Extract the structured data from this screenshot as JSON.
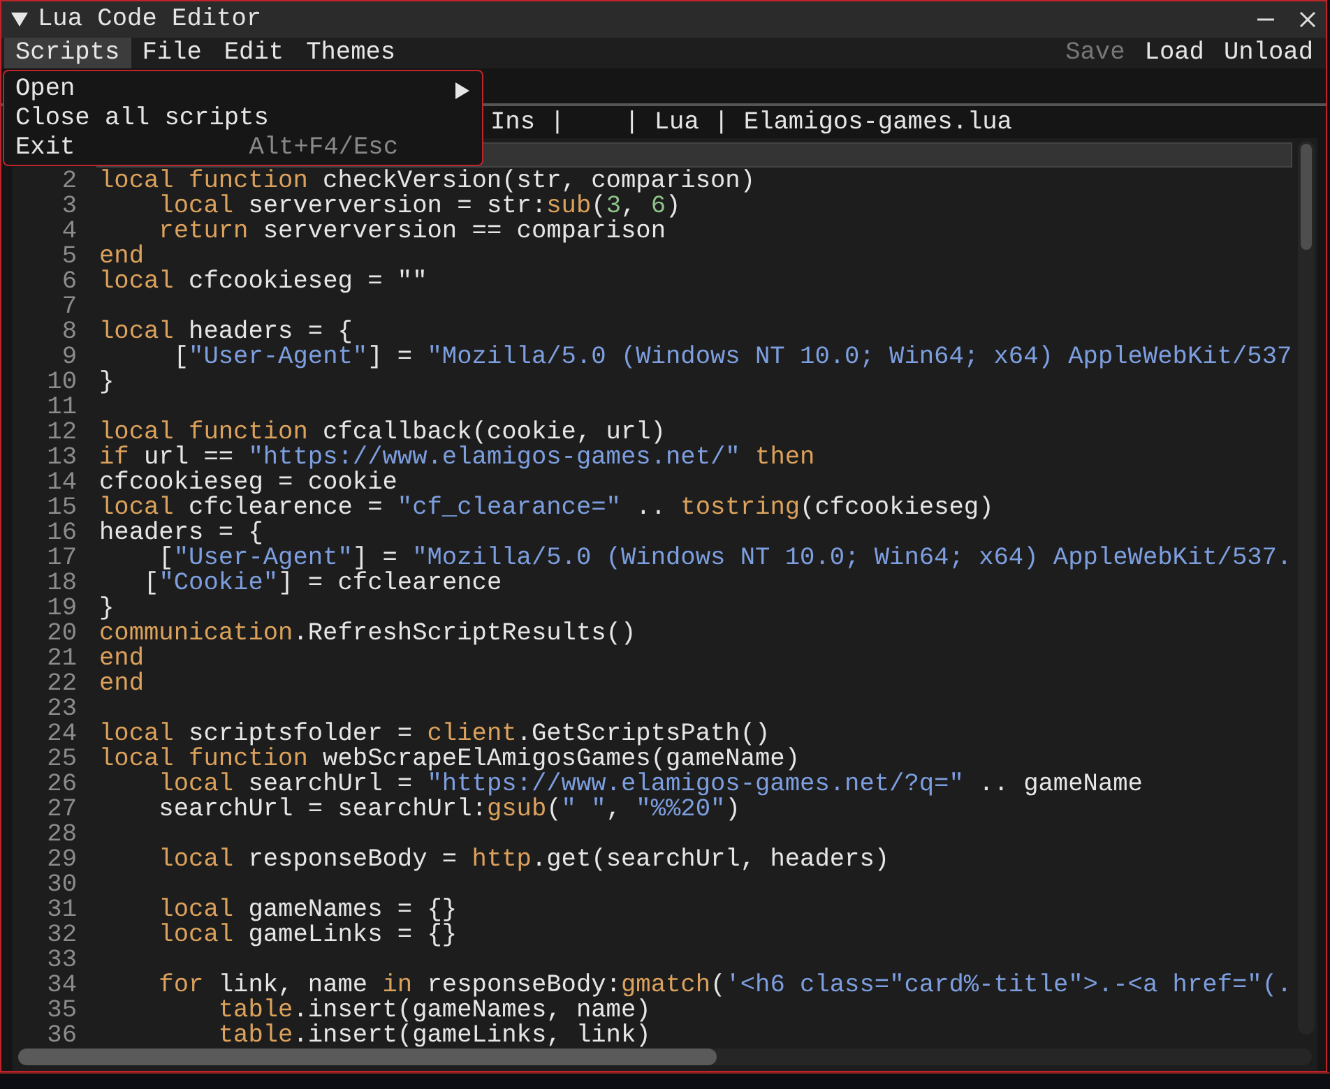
{
  "window": {
    "title": "Lua Code Editor"
  },
  "menu_bar": {
    "items": [
      {
        "label": "Scripts",
        "selected": true
      },
      {
        "label": "File",
        "selected": false
      },
      {
        "label": "Edit",
        "selected": false
      },
      {
        "label": "Themes",
        "selected": false
      }
    ],
    "actions": [
      {
        "label": "Save",
        "disabled": true
      },
      {
        "label": "Load",
        "disabled": false
      },
      {
        "label": "Unload",
        "disabled": false
      }
    ]
  },
  "dropdown": {
    "items": [
      {
        "label": "Open",
        "kind": "submenu"
      },
      {
        "label": "Close all scripts",
        "kind": "plain"
      },
      {
        "label": "Exit",
        "kind": "shortcut",
        "shortcut": "Alt+F4/Esc"
      }
    ]
  },
  "status_bar": "Ins |    | Lua | Elamigos-games.lua",
  "editor": {
    "lines": [
      {
        "number": "2",
        "segments": [
          {
            "text": "local function",
            "kind": "kw"
          },
          {
            "text": " checkVersion(str, comparison)",
            "kind": "plain"
          }
        ]
      },
      {
        "number": "3",
        "segments": [
          {
            "text": "    local",
            "kind": "kw"
          },
          {
            "text": " serverversion = str:",
            "kind": "plain"
          },
          {
            "text": "sub",
            "kind": "kw"
          },
          {
            "text": "(",
            "kind": "plain"
          },
          {
            "text": "3",
            "kind": "num"
          },
          {
            "text": ", ",
            "kind": "plain"
          },
          {
            "text": "6",
            "kind": "num"
          },
          {
            "text": ")",
            "kind": "plain"
          }
        ]
      },
      {
        "number": "4",
        "segments": [
          {
            "text": "    return",
            "kind": "kw"
          },
          {
            "text": " serverversion == comparison",
            "kind": "plain"
          }
        ]
      },
      {
        "number": "5",
        "segments": [
          {
            "text": "end",
            "kind": "kw"
          }
        ]
      },
      {
        "number": "6",
        "segments": [
          {
            "text": "local",
            "kind": "kw"
          },
          {
            "text": " cfcookieseg = \"\"",
            "kind": "plain"
          }
        ]
      },
      {
        "number": "7"
      },
      {
        "number": "8",
        "segments": [
          {
            "text": "local",
            "kind": "kw"
          },
          {
            "text": " headers = {",
            "kind": "plain"
          }
        ]
      },
      {
        "number": "9",
        "segments": [
          {
            "text": "     [",
            "kind": "plain"
          },
          {
            "text": "\"User-Agent\"",
            "kind": "str"
          },
          {
            "text": "] = ",
            "kind": "plain"
          },
          {
            "text": "\"Mozilla/5.0 (Windows NT 10.0; Win64; x64) AppleWebKit/537",
            "kind": "str"
          }
        ]
      },
      {
        "number": "10",
        "segments": [
          {
            "text": "}",
            "kind": "plain"
          }
        ]
      },
      {
        "number": "11"
      },
      {
        "number": "12",
        "segments": [
          {
            "text": "local function",
            "kind": "kw"
          },
          {
            "text": " cfcallback(cookie, url)",
            "kind": "plain"
          }
        ]
      },
      {
        "number": "13",
        "segments": [
          {
            "text": "if",
            "kind": "kw"
          },
          {
            "text": " url == ",
            "kind": "plain"
          },
          {
            "text": "\"https://www.elamigos-games.net/\"",
            "kind": "str"
          },
          {
            "text": " then",
            "kind": "kw"
          }
        ]
      },
      {
        "number": "14",
        "segments": [
          {
            "text": "cfcookieseg = cookie",
            "kind": "plain"
          }
        ]
      },
      {
        "number": "15",
        "segments": [
          {
            "text": "local",
            "kind": "kw"
          },
          {
            "text": " cfclearence = ",
            "kind": "plain"
          },
          {
            "text": "\"cf_clearance=\"",
            "kind": "str"
          },
          {
            "text": " .. ",
            "kind": "plain"
          },
          {
            "text": "tostring",
            "kind": "kw"
          },
          {
            "text": "(cfcookieseg)",
            "kind": "plain"
          }
        ]
      },
      {
        "number": "16",
        "segments": [
          {
            "text": "headers = {",
            "kind": "plain"
          }
        ]
      },
      {
        "number": "17",
        "segments": [
          {
            "text": "    [",
            "kind": "plain"
          },
          {
            "text": "\"User-Agent\"",
            "kind": "str"
          },
          {
            "text": "] = ",
            "kind": "plain"
          },
          {
            "text": "\"Mozilla/5.0 (Windows NT 10.0; Win64; x64) AppleWebKit/537.",
            "kind": "str"
          }
        ]
      },
      {
        "number": "18",
        "segments": [
          {
            "text": "   [",
            "kind": "plain"
          },
          {
            "text": "\"Cookie\"",
            "kind": "str"
          },
          {
            "text": "] = cfclearence",
            "kind": "plain"
          }
        ]
      },
      {
        "number": "19",
        "segments": [
          {
            "text": "}",
            "kind": "plain"
          }
        ]
      },
      {
        "number": "20",
        "segments": [
          {
            "text": "communication",
            "kind": "kw"
          },
          {
            "text": ".RefreshScriptResults()",
            "kind": "plain"
          }
        ]
      },
      {
        "number": "21",
        "segments": [
          {
            "text": "end",
            "kind": "kw"
          }
        ]
      },
      {
        "number": "22",
        "segments": [
          {
            "text": "end",
            "kind": "kw"
          }
        ]
      },
      {
        "number": "23"
      },
      {
        "number": "24",
        "segments": [
          {
            "text": "local",
            "kind": "kw"
          },
          {
            "text": " scriptsfolder = ",
            "kind": "plain"
          },
          {
            "text": "client",
            "kind": "kw"
          },
          {
            "text": ".GetScriptsPath()",
            "kind": "plain"
          }
        ]
      },
      {
        "number": "25",
        "segments": [
          {
            "text": "local function",
            "kind": "kw"
          },
          {
            "text": " webScrapeElAmigosGames(gameName)",
            "kind": "plain"
          }
        ]
      },
      {
        "number": "26",
        "segments": [
          {
            "text": "    local",
            "kind": "kw"
          },
          {
            "text": " searchUrl = ",
            "kind": "plain"
          },
          {
            "text": "\"https://www.elamigos-games.net/?q=\"",
            "kind": "str"
          },
          {
            "text": " .. gameName",
            "kind": "plain"
          }
        ]
      },
      {
        "number": "27",
        "segments": [
          {
            "text": "    searchUrl = searchUrl:",
            "kind": "plain"
          },
          {
            "text": "gsub",
            "kind": "kw"
          },
          {
            "text": "(",
            "kind": "plain"
          },
          {
            "text": "\" \"",
            "kind": "str"
          },
          {
            "text": ", ",
            "kind": "plain"
          },
          {
            "text": "\"%%20\"",
            "kind": "str"
          },
          {
            "text": ")",
            "kind": "plain"
          }
        ]
      },
      {
        "number": "28"
      },
      {
        "number": "29",
        "segments": [
          {
            "text": "    local",
            "kind": "kw"
          },
          {
            "text": " responseBody = ",
            "kind": "plain"
          },
          {
            "text": "http",
            "kind": "kw"
          },
          {
            "text": ".get(searchUrl, headers)",
            "kind": "plain"
          }
        ]
      },
      {
        "number": "30"
      },
      {
        "number": "31",
        "segments": [
          {
            "text": "    local",
            "kind": "kw"
          },
          {
            "text": " gameNames = {}",
            "kind": "plain"
          }
        ]
      },
      {
        "number": "32",
        "segments": [
          {
            "text": "    local",
            "kind": "kw"
          },
          {
            "text": " gameLinks = {}",
            "kind": "plain"
          }
        ]
      },
      {
        "number": "33"
      },
      {
        "number": "34",
        "segments": [
          {
            "text": "    for",
            "kind": "kw"
          },
          {
            "text": " link, name ",
            "kind": "plain"
          },
          {
            "text": "in",
            "kind": "kw"
          },
          {
            "text": " responseBody:",
            "kind": "plain"
          },
          {
            "text": "gmatch",
            "kind": "kw"
          },
          {
            "text": "(",
            "kind": "plain"
          },
          {
            "text": "'<h6 class=\"card%-title\">.-<a href=\"(.",
            "kind": "str"
          }
        ]
      },
      {
        "number": "35",
        "segments": [
          {
            "text": "        table",
            "kind": "kw"
          },
          {
            "text": ".insert(gameNames, name)",
            "kind": "plain"
          }
        ]
      },
      {
        "number": "36",
        "segments": [
          {
            "text": "        table",
            "kind": "kw"
          },
          {
            "text": ".insert(gameLinks, link)",
            "kind": "plain"
          }
        ]
      }
    ]
  }
}
